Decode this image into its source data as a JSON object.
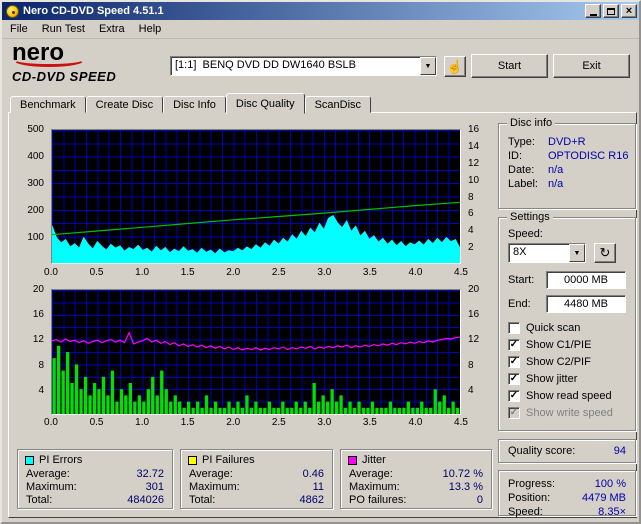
{
  "window": {
    "title": "Nero CD-DVD Speed 4.51.1"
  },
  "menu": {
    "items": [
      "File",
      "Run Test",
      "Extra",
      "Help"
    ]
  },
  "brand": {
    "line1": "nero",
    "line2": "CD-DVD SPEED"
  },
  "toolbar": {
    "drive_selector": "[1:1]  BENQ DVD DD DW1640 BSLB",
    "start_label": "Start",
    "exit_label": "Exit"
  },
  "icons": {
    "chevron_down": "▼",
    "refresh": "↻",
    "hand": "☝",
    "close": "×"
  },
  "tabs": [
    {
      "label": "Benchmark",
      "active": false
    },
    {
      "label": "Create Disc",
      "active": false
    },
    {
      "label": "Disc Info",
      "active": false
    },
    {
      "label": "Disc Quality",
      "active": true
    },
    {
      "label": "ScanDisc",
      "active": false
    }
  ],
  "disc_info": {
    "title": "Disc info",
    "rows": [
      {
        "label": "Type:",
        "value": "DVD+R"
      },
      {
        "label": "ID:",
        "value": "OPTODISC R16"
      },
      {
        "label": "Date:",
        "value": "n/a"
      },
      {
        "label": "Label:",
        "value": "n/a"
      }
    ]
  },
  "settings": {
    "title": "Settings",
    "speed_label": "Speed:",
    "speed_value": "8X",
    "start_label": "Start:",
    "start_value": "0000 MB",
    "end_label": "End:",
    "end_value": "4480 MB",
    "checkboxes": [
      {
        "label": "Quick scan",
        "checked": false,
        "disabled": false
      },
      {
        "label": "Show C1/PIE",
        "checked": true,
        "disabled": false
      },
      {
        "label": "Show C2/PIF",
        "checked": true,
        "disabled": false
      },
      {
        "label": "Show jitter",
        "checked": true,
        "disabled": false
      },
      {
        "label": "Show read speed",
        "checked": true,
        "disabled": false
      },
      {
        "label": "Show write speed",
        "checked": true,
        "disabled": true
      }
    ]
  },
  "quality": {
    "label": "Quality score:",
    "value": "94"
  },
  "progress": {
    "rows": [
      {
        "label": "Progress:",
        "value": "100 %"
      },
      {
        "label": "Position:",
        "value": "4479 MB"
      },
      {
        "label": "Speed:",
        "value": "8.35×"
      }
    ]
  },
  "stats": [
    {
      "title": "PI Errors",
      "swatch": "#00ffff",
      "rows": [
        [
          "Average:",
          "32.72"
        ],
        [
          "Maximum:",
          "301"
        ],
        [
          "Total:",
          "484026"
        ]
      ]
    },
    {
      "title": "PI Failures",
      "swatch": "#ffff00",
      "rows": [
        [
          "Average:",
          "0.46"
        ],
        [
          "Maximum:",
          "11"
        ],
        [
          "Total:",
          "4862"
        ]
      ]
    },
    {
      "title": "Jitter",
      "swatch": "#ff00ff",
      "rows": [
        [
          "Average:",
          "10.72 %"
        ],
        [
          "Maximum:",
          "13.3 %"
        ],
        [
          "PO failures:",
          "0"
        ]
      ]
    }
  ],
  "chart_data": [
    {
      "type": "area",
      "name": "pi-errors-and-read-speed",
      "x_max": 4.5,
      "y_left_max": 500,
      "y_right_max": 16,
      "x_ticks": [
        "0.0",
        "0.5",
        "1.0",
        "1.5",
        "2.0",
        "2.5",
        "3.0",
        "3.5",
        "4.0",
        "4.5"
      ],
      "y_left_ticks": [
        "500",
        "400",
        "300",
        "200",
        "100"
      ],
      "y_right_ticks": [
        "16",
        "14",
        "12",
        "10",
        "8",
        "6",
        "4",
        "2"
      ],
      "series": [
        {
          "name": "PI Errors",
          "type": "area",
          "axis": "left",
          "color": "#00ffff",
          "step": 0.05,
          "values": [
            140,
            95,
            75,
            88,
            60,
            72,
            55,
            95,
            70,
            52,
            80,
            62,
            48,
            70,
            56,
            64,
            44,
            58,
            50,
            66,
            47,
            55,
            40,
            62,
            45,
            58,
            38,
            52,
            42,
            60,
            44,
            50,
            36,
            55,
            40,
            48,
            34,
            52,
            38,
            46,
            42,
            55,
            45,
            60,
            50,
            68,
            55,
            75,
            62,
            85,
            70,
            92,
            78,
            105,
            88,
            118,
            98,
            130,
            112,
            148,
            125,
            168,
            178,
            150,
            132,
            158,
            118,
            138,
            100,
            118,
            88,
            102,
            78,
            92,
            70,
            85,
            64,
            80,
            60,
            75,
            68,
            82,
            66,
            88,
            72,
            92,
            76,
            95,
            80,
            88,
            55
          ]
        },
        {
          "name": "Read speed",
          "type": "line",
          "axis": "right",
          "color": "#00c000",
          "step": 0.5,
          "values": [
            3.4,
            3.85,
            4.3,
            4.75,
            5.2,
            5.6,
            6.0,
            6.45,
            6.9,
            7.3
          ]
        }
      ]
    },
    {
      "type": "bar",
      "name": "pi-failures-and-jitter",
      "x_max": 4.5,
      "y_left_max": 20,
      "y_right_max": 20,
      "x_ticks": [
        "0.0",
        "0.5",
        "1.0",
        "1.5",
        "2.0",
        "2.5",
        "3.0",
        "3.5",
        "4.0",
        "4.5"
      ],
      "y_left_ticks": [
        "20",
        "16",
        "12",
        "8",
        "4"
      ],
      "y_right_ticks": [
        "20",
        "16",
        "12",
        "8",
        "4"
      ],
      "series": [
        {
          "name": "PI Failures",
          "type": "bars",
          "axis": "left",
          "color": "#00e000",
          "step": 0.05,
          "values": [
            9,
            11,
            7,
            10,
            5,
            8,
            4,
            6,
            3,
            5,
            4,
            6,
            3,
            7,
            2,
            4,
            3,
            5,
            2,
            3,
            2,
            4,
            6,
            3,
            7,
            4,
            2,
            3,
            2,
            1,
            2,
            1,
            2,
            1,
            3,
            1,
            2,
            1,
            1,
            2,
            1,
            2,
            1,
            3,
            1,
            2,
            1,
            1,
            2,
            1,
            1,
            2,
            1,
            1,
            2,
            1,
            2,
            1,
            5,
            2,
            3,
            2,
            4,
            2,
            3,
            1,
            2,
            1,
            2,
            1,
            1,
            2,
            1,
            1,
            1,
            2,
            1,
            1,
            1,
            2,
            1,
            1,
            2,
            1,
            1,
            4,
            2,
            3,
            1,
            2,
            1
          ]
        },
        {
          "name": "Jitter",
          "type": "line",
          "axis": "left",
          "color": "#ff00ff",
          "step": 0.05,
          "values": [
            11.8,
            12.0,
            11.6,
            12.1,
            11.7,
            11.9,
            11.5,
            11.8,
            11.4,
            11.7,
            11.9,
            11.5,
            11.8,
            12.0,
            11.6,
            11.9,
            11.5,
            13.1,
            11.3,
            11.6,
            11.8,
            12.2,
            11.6,
            11.9,
            11.4,
            11.7,
            11.2,
            11.5,
            11.0,
            11.3,
            10.9,
            11.2,
            10.8,
            11.1,
            10.7,
            11.0,
            10.6,
            10.9,
            10.5,
            10.8,
            10.4,
            10.7,
            10.3,
            10.6,
            10.4,
            10.7,
            10.3,
            10.6,
            10.4,
            10.7,
            10.5,
            10.8,
            10.4,
            10.7,
            10.5,
            10.8,
            10.6,
            10.9,
            10.5,
            10.8,
            10.6,
            10.9,
            10.7,
            11.0,
            10.8,
            11.1,
            10.7,
            11.0,
            10.8,
            11.1,
            10.9,
            11.2,
            11.0,
            11.3,
            11.1,
            11.4,
            11.2,
            11.5,
            11.3,
            11.6,
            11.4,
            11.7,
            11.5,
            11.8,
            11.6,
            11.9,
            12.0,
            12.2,
            12.1,
            12.3,
            12.4
          ]
        }
      ]
    }
  ]
}
